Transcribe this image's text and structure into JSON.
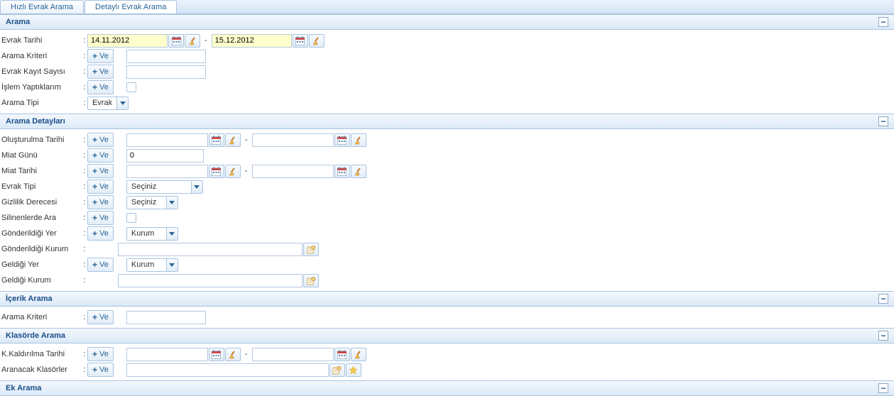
{
  "tabs": {
    "quick": "Hızlı Evrak Arama",
    "detailed": "Detaylı Evrak Arama"
  },
  "ve_label": "Ve",
  "dash": "-",
  "arama": {
    "title": "Arama",
    "evrak_tarihi": "Evrak Tarihi",
    "date_from": "14.11.2012",
    "date_to": "15.12.2012",
    "arama_kriteri": "Arama Kriteri",
    "evrak_kayit_sayisi": "Evrak Kayıt Sayısı",
    "islem_yaptiklarim": "İşlem Yaptıklarım",
    "arama_tipi": "Arama Tipi",
    "arama_tipi_val": "Evrak"
  },
  "detaylar": {
    "title": "Arama Detayları",
    "olusturulma_tarihi": "Oluşturulma Tarihi",
    "miat_gunu": "Miat Günü",
    "miat_gunu_val": "0",
    "miat_tarihi": "Miat Tarihi",
    "evrak_tipi": "Evrak Tipi",
    "evrak_tipi_val": "Seçiniz",
    "gizlilik": "Gizlilik Derecesi",
    "gizlilik_val": "Seçiniz",
    "silinenlerde": "Silinenlerde Ara",
    "gonderildigi_yer": "Gönderildiği Yer",
    "gonderildigi_yer_val": "Kurum",
    "gonderildigi_kurum": "Gönderildiği Kurum",
    "geldigi_yer": "Geldiği Yer",
    "geldigi_yer_val": "Kurum",
    "geldigi_kurum": "Geldiği Kurum"
  },
  "icerik": {
    "title": "İçerik Arama",
    "arama_kriteri": "Arama Kriteri"
  },
  "klasor": {
    "title": "Klasörde Arama",
    "kaldirilma_tarihi": "K.Kaldırılma Tarihi",
    "aranacak_klasorler": "Aranacak Klasörler"
  },
  "ek": {
    "title": "Ek Arama"
  }
}
